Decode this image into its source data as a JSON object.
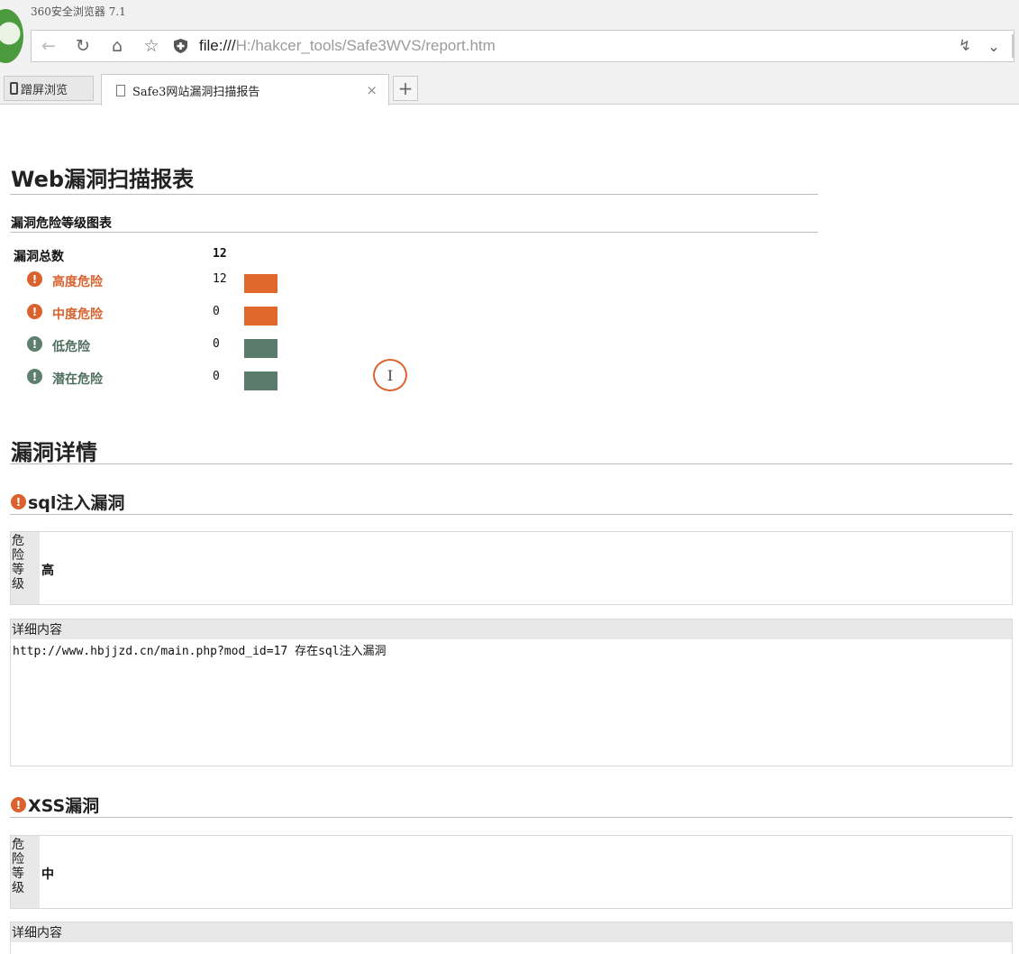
{
  "browser": {
    "title": "360安全浏览器 7.1",
    "url_scheme": "file:///",
    "url_path": "H:/hakcer_tools/Safe3WVS/report.htm",
    "side_tab_label": "蹭屏浏览",
    "active_tab_label": "Safe3网站漏洞扫描报告",
    "close_glyph": "×",
    "new_tab_glyph": "+",
    "icons": [
      "browser-logo",
      "back-arrow-icon",
      "reload-icon",
      "home-icon",
      "star-icon",
      "shield-icon",
      "bolt-icon",
      "chevron-down-icon",
      "phone-icon",
      "page-icon"
    ]
  },
  "report": {
    "title": "Web漏洞扫描报表",
    "chart_heading": "漏洞危险等级图表",
    "total_label": "漏洞总数",
    "total_count": "12",
    "levels": [
      {
        "label": "高度危险",
        "count": "12",
        "color": "#e0682c",
        "icon_color": "#d9622e"
      },
      {
        "label": "中度危险",
        "count": "0",
        "color": "#e0682c",
        "icon_color": "#d9622e"
      },
      {
        "label": "低危险",
        "count": "0",
        "color": "#5a7b6c",
        "icon_color": "#5f7f70"
      },
      {
        "label": "潜在危险",
        "count": "0",
        "color": "#5a7b6c",
        "icon_color": "#5f7f70"
      }
    ],
    "warn_glyph": "!",
    "cursor_glyph": "I",
    "details_title": "漏洞详情",
    "vulns": [
      {
        "title": "sql注入漏洞",
        "level_key": "危险等级",
        "level_value": "高",
        "detail_head": "详细内容",
        "detail_text": "http://www.hbjjzd.cn/main.php?mod_id=17 存在sql注入漏洞"
      },
      {
        "title": "XSS漏洞",
        "level_key": "危险等级",
        "level_value": "中",
        "detail_head": "详细内容",
        "detail_text": ""
      }
    ]
  },
  "colors": {
    "high": "#e0682c",
    "low": "#5a7b6c",
    "high_text": "#d9622e",
    "low_text": "#4f6e60"
  }
}
